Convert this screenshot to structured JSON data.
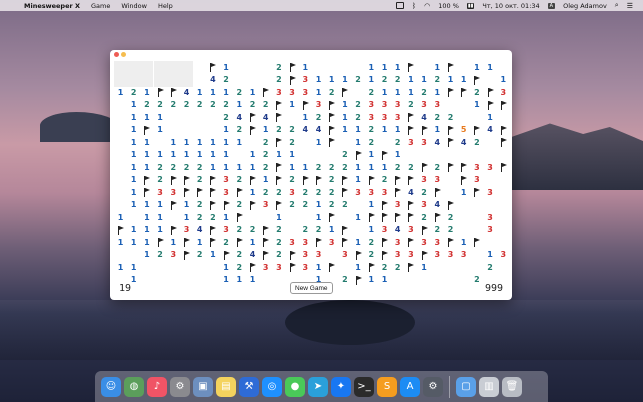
{
  "menubar": {
    "app_name": "Minesweeper X",
    "menus": [
      "Game",
      "Window",
      "Help"
    ],
    "battery": "100 %",
    "datetime": "Чт, 10 окт.  01:34",
    "input_source": "A",
    "user": "Oleg Adamov"
  },
  "game": {
    "mines_left": "19",
    "timer": "999",
    "new_game_label": "New Game",
    "colors": {
      "1": "#1a5fb4",
      "2": "#237b6e",
      "3": "#d12f2f",
      "4": "#1e3a8a",
      "5": "#e87a1e"
    },
    "grid": [
      "Hhhhhh F1   2F1    111F 1F 11",
      "Hhhhhh 42   2F3111212211211F 1",
      "121FF411121F33312F 211121FF2F3",
      " 12222222122F1F3F12333233  1FF",
      " 111    24F4F 12F12333F422  1",
      " 1F1    12F12244F11211FF1F5F4F",
      " 11 111111 2F2 1F 12 2334F42 F",
      " 11111111 1211   2F1F1",
      " 11222211112F1122211122F2FF33F",
      " 1F2FF2F32F1F2FF2F1F2FF33 F3",
      " 1F33FFF3F1223222F333F42F 1F3",
      " 111F12FF2F3F22122 1F3F34F",
      "1 11 1221F  1  1F 1FFFF2F2  3",
      "F111F34F322F2 221F 1343F22  3",
      "111F1F1F2F1F233F3F12F3F33F1F  2",
      "  123F21F24F2F33 3F2F33F333 13",
      "11      12F33F31F 1F22F1    2",
      " 1      111    1 2F11      2"
    ]
  },
  "dock": {
    "items": [
      {
        "name": "finder-icon",
        "glyph": "☺",
        "color": "#3a8ee6"
      },
      {
        "name": "maps-icon",
        "glyph": "◍",
        "color": "#5b9e5b"
      },
      {
        "name": "music-icon",
        "glyph": "♪",
        "color": "#f05466"
      },
      {
        "name": "system-preferences-icon",
        "glyph": "⚙",
        "color": "#8a8a8f"
      },
      {
        "name": "preview-icon",
        "glyph": "▣",
        "color": "#6d8fbf"
      },
      {
        "name": "notes-icon",
        "glyph": "▤",
        "color": "#f4d35e"
      },
      {
        "name": "xcode-icon",
        "glyph": "⚒",
        "color": "#2e6bd6"
      },
      {
        "name": "safari-icon",
        "glyph": "◎",
        "color": "#1e90ff"
      },
      {
        "name": "messages-icon",
        "glyph": "●",
        "color": "#4ac959"
      },
      {
        "name": "telegram-icon",
        "glyph": "➤",
        "color": "#2aa0da"
      },
      {
        "name": "messenger-icon",
        "glyph": "✦",
        "color": "#1877f2"
      },
      {
        "name": "terminal-icon",
        "glyph": ">_",
        "color": "#2b2b2b"
      },
      {
        "name": "sublime-icon",
        "glyph": "S",
        "color": "#f59d1f"
      },
      {
        "name": "app-store-icon",
        "glyph": "A",
        "color": "#1c8cf4"
      },
      {
        "name": "settings-gear-icon",
        "glyph": "⚙",
        "color": "#555b66"
      },
      {
        "name": "downloads-folder-icon",
        "glyph": "▢",
        "color": "#5aa0e8"
      },
      {
        "name": "documents-stack-icon",
        "glyph": "▥",
        "color": "#c9cdd4"
      },
      {
        "name": "trash-icon",
        "glyph": "🗑",
        "color": "#b8bcc4"
      }
    ]
  }
}
